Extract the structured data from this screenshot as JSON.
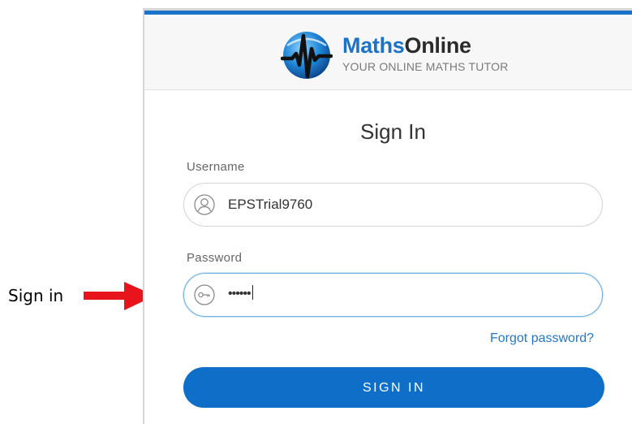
{
  "annotation": {
    "label": "Sign in",
    "arrow_color": "#e8141b"
  },
  "brand": {
    "name_part1": "Maths",
    "name_part2": "Online",
    "tagline": "YOUR ONLINE MATHS TUTOR",
    "logo_icon": "heartbeat-globe-icon",
    "accent_color": "#1d72c8"
  },
  "form": {
    "title": "Sign In",
    "username_label": "Username",
    "username_value": "EPSTrial9760",
    "username_icon": "user-icon",
    "password_label": "Password",
    "password_value": "••••••",
    "password_icon": "key-icon",
    "forgot_link": "Forgot password?",
    "submit_label": "SIGN IN",
    "button_color": "#0f6fc8"
  }
}
